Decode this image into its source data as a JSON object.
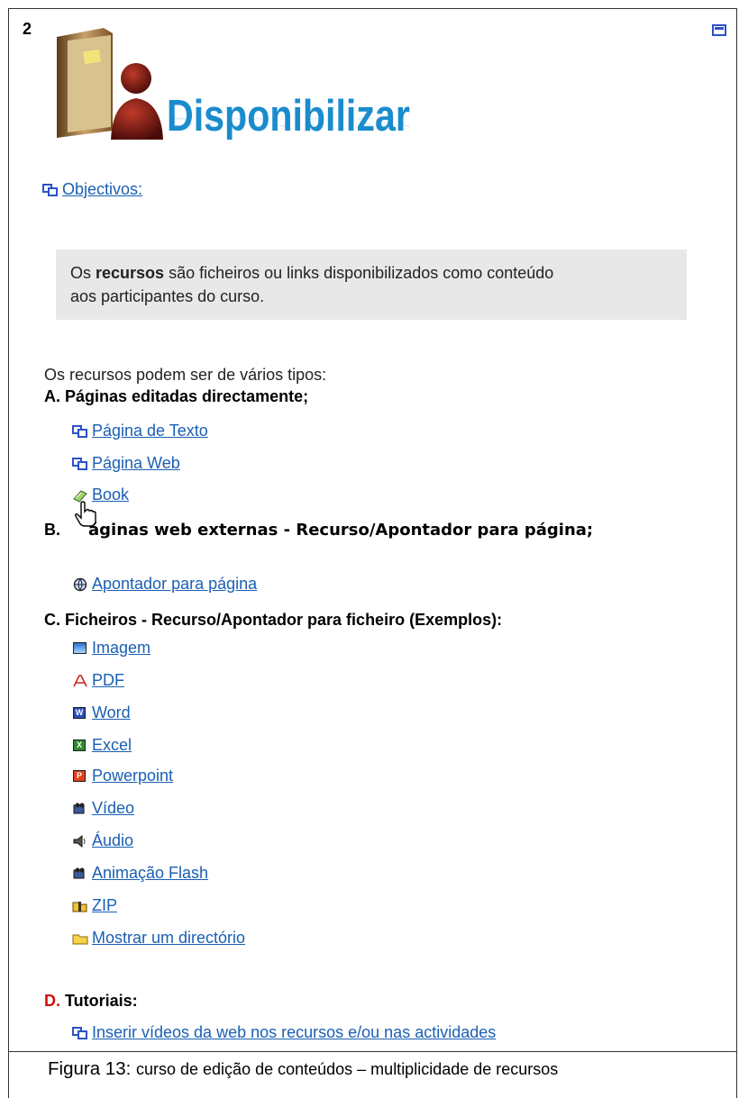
{
  "section_number": "2",
  "banner_title": "Disponibilizar",
  "objectives_link": "Objectivos:",
  "info_box": {
    "bold": "recursos",
    "pre": "Os ",
    "post": " são ficheiros ou links disponibilizados como conteúdo",
    "line2": "aos participantes do curso."
  },
  "intro": "Os recursos podem ser de vários tipos:",
  "section_a": {
    "heading": "A. Páginas editadas directamente;",
    "links": [
      "Página de Texto",
      "Página Web",
      "Book"
    ]
  },
  "section_b": {
    "heading_pre": "B. ",
    "heading_post": "áginas web externas - Recurso/Apontador para página;",
    "links": [
      "Apontador para página"
    ]
  },
  "section_c": {
    "heading": "C. Ficheiros - Recurso/Apontador para ficheiro (Exemplos):",
    "links": [
      "Imagem",
      "PDF",
      "Word",
      "Excel",
      "Powerpoint",
      "Vídeo",
      "Áudio",
      "Animação Flash",
      "ZIP",
      "Mostrar um directório"
    ]
  },
  "section_d": {
    "letter": "D.",
    "heading": " Tutoriais:",
    "links": [
      "Inserir vídeos da web nos recursos e/ou nas actividades"
    ]
  },
  "caption": {
    "prefix": "Figura 13: ",
    "text": "curso de edição de conteúdos – multiplicidade de recursos"
  },
  "colors": {
    "link": "#1a5fb4",
    "banner": "#1a8ccd",
    "accent_red": "#d01010"
  }
}
